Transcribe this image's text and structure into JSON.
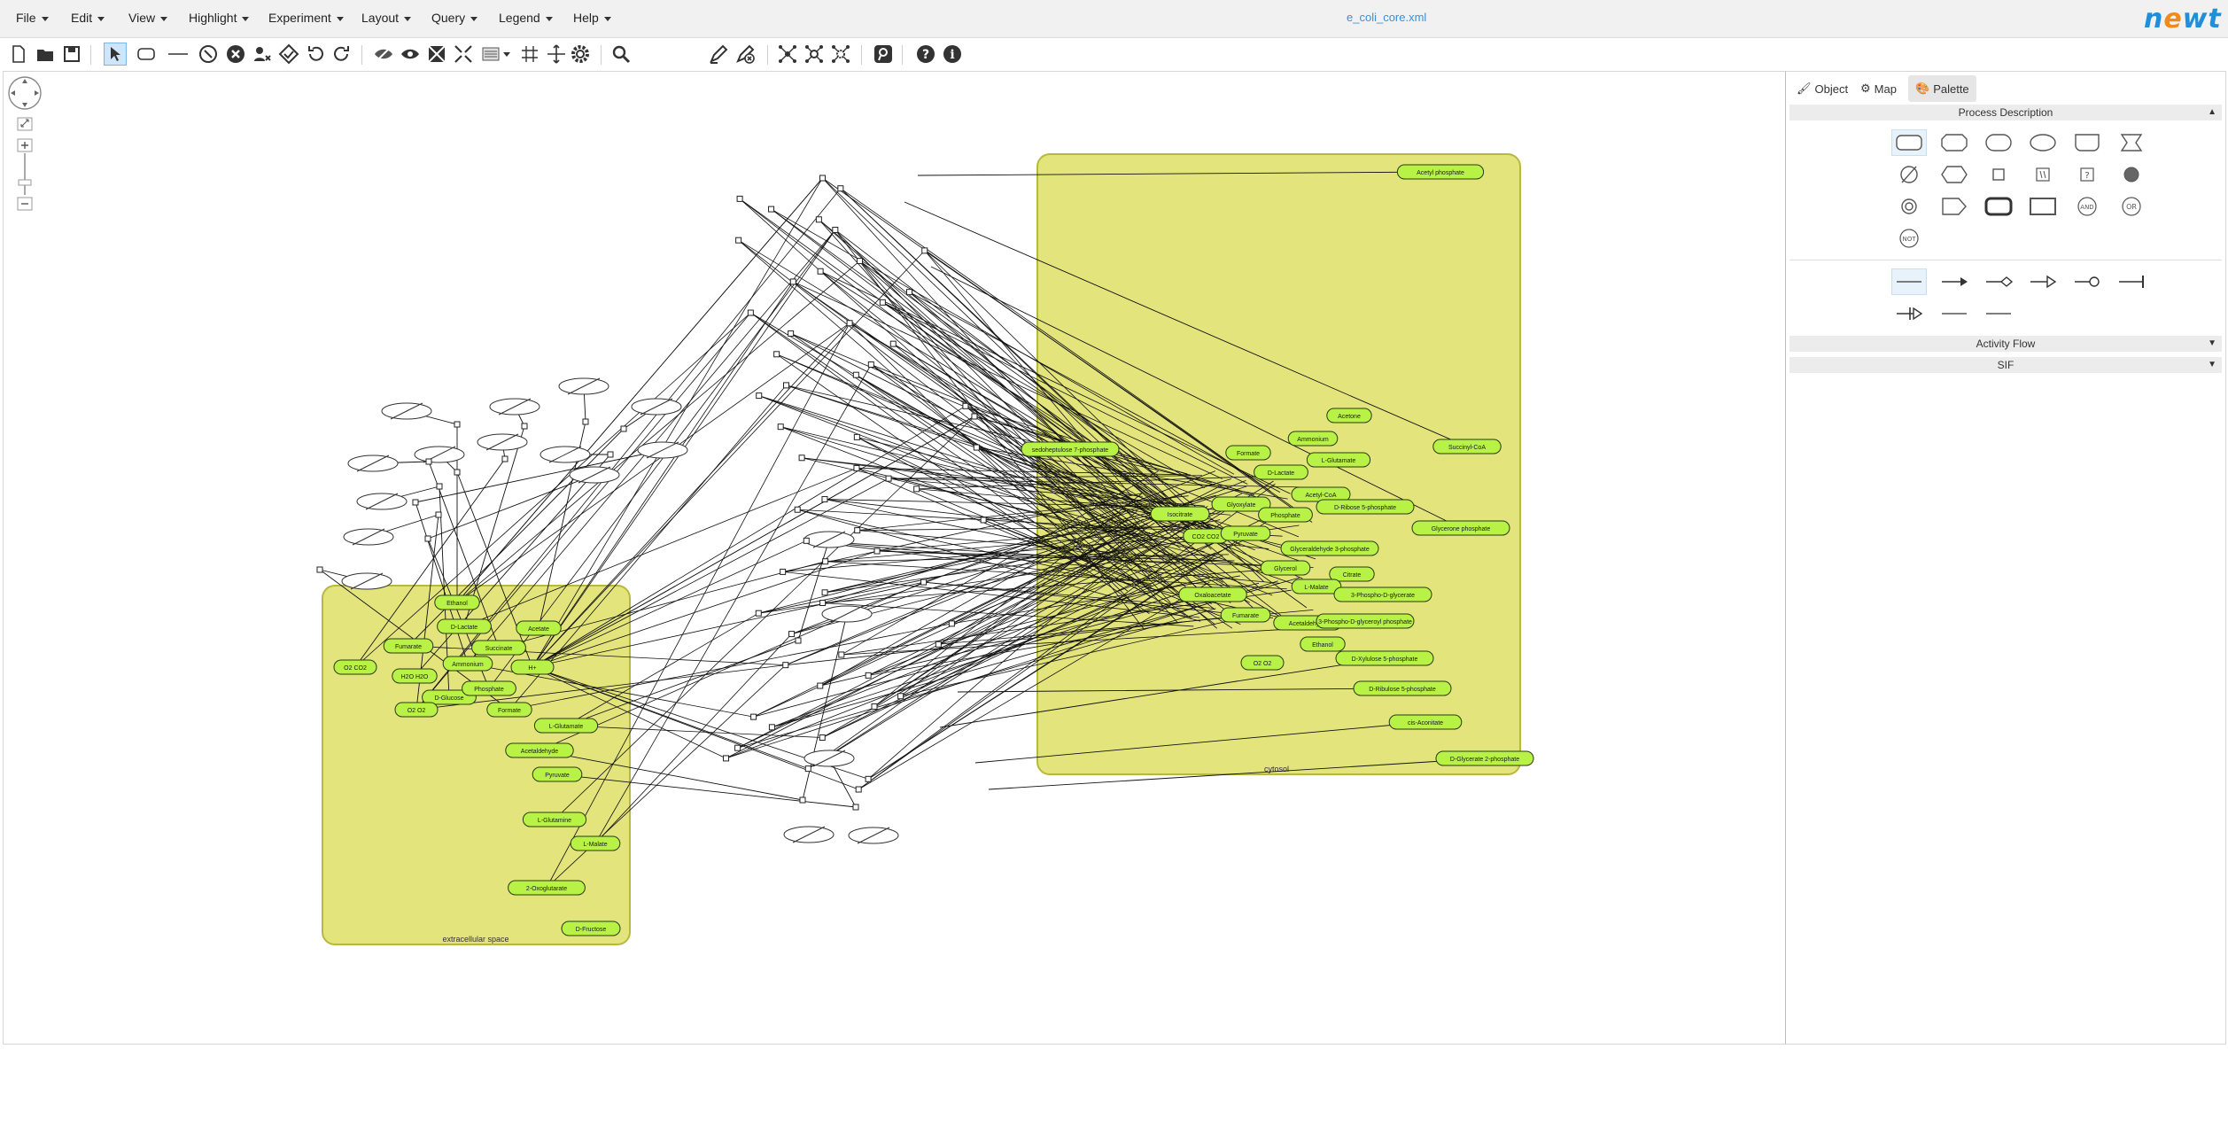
{
  "menu": [
    "File",
    "Edit",
    "View",
    "Highlight",
    "Experiment",
    "Layout",
    "Query",
    "Legend",
    "Help"
  ],
  "document_title": "e_coli_core.xml",
  "logo_text": "newt",
  "toolbar": {
    "zoom_value": "",
    "icons": [
      "new-file-icon",
      "open-file-icon",
      "save-icon",
      "select-pointer-icon",
      "add-node-icon",
      "add-edge-icon",
      "delete-icon",
      "delete-selective-icon",
      "filter-icon",
      "validate-icon",
      "undo-icon",
      "redo-icon",
      "hide-icon",
      "show-icon",
      "compound-collapse-icon",
      "expand-icon",
      "align-icon",
      "grid-icon",
      "resize-icon",
      "settings-icon",
      "zoom-icon",
      "highlight-neighbors-icon",
      "highlight-processes-icon",
      "highlight-by-path-icon",
      "highlight-more-icon",
      "remove-highlight-icon",
      "query-icon",
      "help-icon",
      "info-icon"
    ]
  },
  "panel": {
    "tabs": [
      "Object",
      "Map",
      "Palette"
    ],
    "active_tab": "Palette",
    "sections": [
      "Process Description",
      "Activity Flow",
      "SIF"
    ]
  },
  "compartments": [
    {
      "label": "cytosol"
    },
    {
      "label": "extracellular space"
    }
  ],
  "ext_nodes": [
    "Ethanol",
    "D-Lactate",
    "Acetate",
    "Fumarate",
    "Succinate",
    "H+",
    "O2 CO2",
    "H2O H2O",
    "Ammonium",
    "D-Glucose",
    "Phosphate",
    "O2 O2",
    "Formate",
    "L-Glutamate",
    "Acetaldehyde",
    "Pyruvate",
    "L-Glutamine",
    "L-Malate",
    "2-Oxoglutarate",
    "D-Fructose"
  ],
  "cyt_nodes": [
    "Acetyl phosphate",
    "Acetone",
    "Ammonium",
    "Succinyl-CoA",
    "Formate",
    "L-Glutamate",
    "D-Lactate",
    "sedoheptulose 7-phosphate",
    "Acetyl-CoA",
    "D-Ribose 5-phosphate",
    "Glyoxylate",
    "Isocitrate",
    "Phosphate",
    "Glycerone phosphate",
    "CO2 CO2",
    "Pyruvate",
    "Citrate",
    "L-Malate",
    "Oxaloacetate",
    "Fumarate",
    "Acetaldehyde",
    "Ethanol",
    "O2 O2",
    "D-Xylulose 5-phosphate",
    "D-Ribulose 5-phosphate",
    "cis-Aconitate",
    "D-Glycerate 2-phosphate",
    "Glyceraldehyde 3-phosphate",
    "3-Phospho-D-glycerate",
    "3-Phospho-D-glyceroyl phosphate",
    "Glycerol"
  ]
}
